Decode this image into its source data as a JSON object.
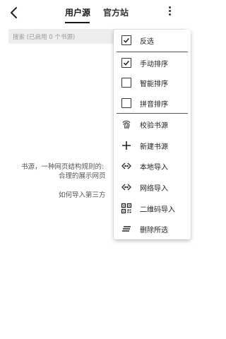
{
  "header": {
    "tabs": [
      {
        "label": "用户源",
        "active": true
      },
      {
        "label": "官方站",
        "active": false
      }
    ]
  },
  "search": {
    "placeholder": "搜索 (已启用 0 个书源)"
  },
  "empty": {
    "line1": "书源，一种网页结构规则的:",
    "line2": "合理的展示网页",
    "line3": "如何导入第三方"
  },
  "menu": {
    "items": [
      {
        "label": "反选",
        "icon": "checkbox-checked-icon",
        "checked": true
      },
      {
        "label": "手动排序",
        "icon": "checkbox-checked-icon",
        "checked": true
      },
      {
        "label": "智能排序",
        "icon": "checkbox-empty-icon",
        "checked": false
      },
      {
        "label": "拼音排序",
        "icon": "checkbox-empty-icon",
        "checked": false
      },
      {
        "label": "校验书源",
        "icon": "fingerprint-icon"
      },
      {
        "label": "新建书源",
        "icon": "plus-icon"
      },
      {
        "label": "本地导入",
        "icon": "code-arrows-icon"
      },
      {
        "label": "网络导入",
        "icon": "code-arrows-icon"
      },
      {
        "label": "二维码导入",
        "icon": "qrcode-icon"
      },
      {
        "label": "删除所选",
        "icon": "delete-lines-icon"
      }
    ]
  },
  "colors": {
    "accent": "#1a1a1a",
    "search_bg": "#ededed",
    "muted_text": "#999999"
  }
}
